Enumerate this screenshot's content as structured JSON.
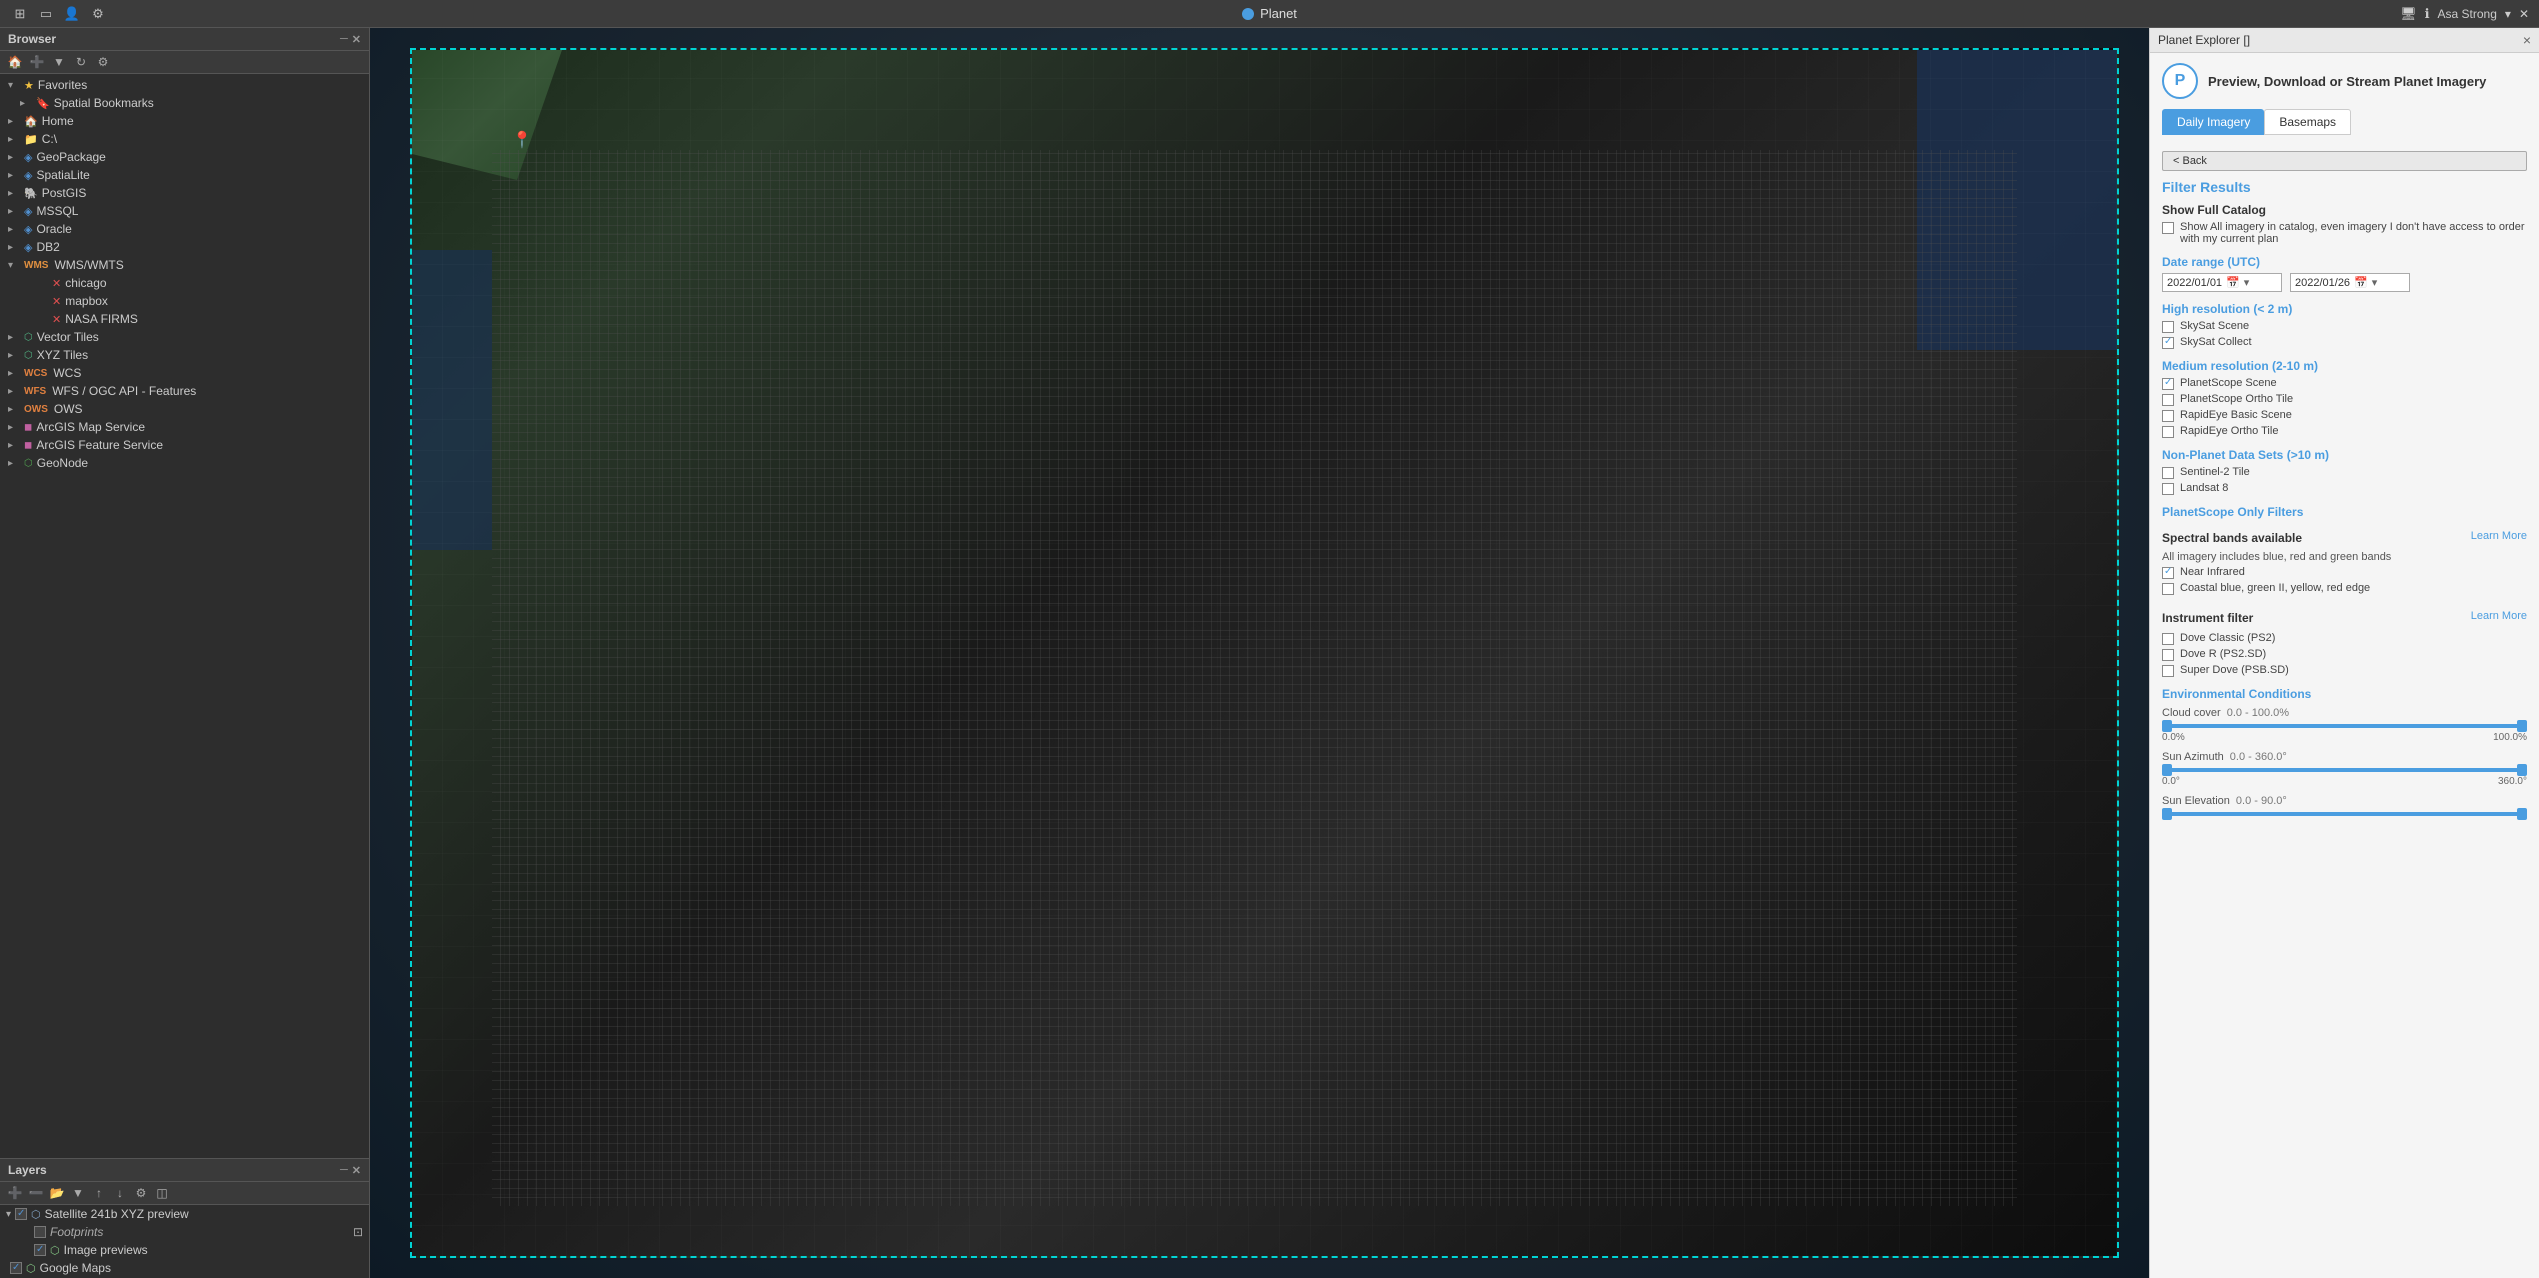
{
  "topbar": {
    "title": "Planet",
    "user": "Asa Strong",
    "icons": [
      "grid-icon",
      "tab-icon",
      "user-icon",
      "settings-icon"
    ]
  },
  "browser": {
    "panel_title": "Browser",
    "toolbar_icons": [
      "home-icon",
      "add-icon",
      "filter-icon",
      "refresh-icon",
      "settings-icon"
    ],
    "tree_items": [
      {
        "label": "Favorites",
        "indent": 0,
        "type": "star",
        "expanded": true
      },
      {
        "label": "Spatial Bookmarks",
        "indent": 1,
        "type": "bookmark"
      },
      {
        "label": "Home",
        "indent": 0,
        "type": "folder",
        "expanded": false
      },
      {
        "label": "C:\\",
        "indent": 0,
        "type": "folder",
        "expanded": false
      },
      {
        "label": "GeoPackage",
        "indent": 0,
        "type": "folder",
        "expanded": false
      },
      {
        "label": "SpatiaLite",
        "indent": 0,
        "type": "folder",
        "expanded": false
      },
      {
        "label": "PostGIS",
        "indent": 0,
        "type": "db",
        "expanded": false
      },
      {
        "label": "MSSQL",
        "indent": 0,
        "type": "db",
        "expanded": false
      },
      {
        "label": "Oracle",
        "indent": 0,
        "type": "db",
        "expanded": false
      },
      {
        "label": "DB2",
        "indent": 0,
        "type": "db",
        "expanded": false
      },
      {
        "label": "WMS/WMTS",
        "indent": 0,
        "type": "wms",
        "expanded": true
      },
      {
        "label": "chicago",
        "indent": 1,
        "type": "cross"
      },
      {
        "label": "mapbox",
        "indent": 1,
        "type": "cross"
      },
      {
        "label": "NASA FIRMS",
        "indent": 1,
        "type": "cross"
      },
      {
        "label": "Vector Tiles",
        "indent": 0,
        "type": "tile",
        "expanded": false
      },
      {
        "label": "XYZ Tiles",
        "indent": 0,
        "type": "tile",
        "expanded": false
      },
      {
        "label": "WCS",
        "indent": 0,
        "type": "wms",
        "expanded": false
      },
      {
        "label": "WFS / OGC API - Features",
        "indent": 0,
        "type": "wms",
        "expanded": false
      },
      {
        "label": "OWS",
        "indent": 0,
        "type": "wms",
        "expanded": false
      },
      {
        "label": "ArcGIS Map Service",
        "indent": 0,
        "type": "tile",
        "expanded": false
      },
      {
        "label": "ArcGIS Feature Service",
        "indent": 0,
        "type": "tile",
        "expanded": false
      },
      {
        "label": "GeoNode",
        "indent": 0,
        "type": "tile",
        "expanded": false
      }
    ]
  },
  "layers": {
    "panel_title": "Layers",
    "toolbar_icons": [
      "add-layer",
      "remove-layer",
      "open-layer",
      "filter-layer",
      "move-up",
      "move-down",
      "properties",
      "group"
    ],
    "items": [
      {
        "label": "Satellite 241b XYZ preview",
        "checked": true,
        "visible": true,
        "expanded": true
      },
      {
        "label": "Footprints",
        "checked": false,
        "visible": false,
        "indent": 1
      },
      {
        "label": "Image previews",
        "checked": true,
        "visible": true,
        "indent": 1
      },
      {
        "label": "Google Maps",
        "checked": true,
        "visible": true,
        "indent": 0
      }
    ]
  },
  "planet_explorer": {
    "panel_title": "Planet Explorer []",
    "close_label": "×",
    "logo_letter": "P",
    "header_title": "Preview, Download or Stream Planet Imagery",
    "tabs": [
      {
        "label": "Daily Imagery",
        "active": true
      },
      {
        "label": "Basemaps",
        "active": false
      }
    ],
    "back_btn": "< Back",
    "filter_results_title": "Filter Results",
    "show_full_catalog_label": "Show Full Catalog",
    "full_catalog_text": "Show All imagery in catalog, even imagery I don't have access to order with my current plan",
    "date_range_label": "Date range (UTC)",
    "date_start": "2022/01/01",
    "date_end": "2022/01/26",
    "high_res_label": "High resolution (< 2 m)",
    "high_res_items": [
      {
        "label": "SkySat Scene",
        "checked": false
      },
      {
        "label": "SkySat Collect",
        "checked": true
      }
    ],
    "medium_res_label": "Medium resolution (2-10 m)",
    "medium_res_items": [
      {
        "label": "PlanetScope Scene",
        "checked": true
      },
      {
        "label": "PlanetScope Ortho Tile",
        "checked": false
      },
      {
        "label": "RapidEye Basic Scene",
        "checked": false
      },
      {
        "label": "RapidEye Ortho Tile",
        "checked": false
      }
    ],
    "non_planet_label": "Non-Planet Data Sets (>10 m)",
    "non_planet_items": [
      {
        "label": "Sentinel-2 Tile",
        "checked": false
      },
      {
        "label": "Landsat 8",
        "checked": false
      }
    ],
    "planetscope_only_label": "PlanetScope Only Filters",
    "spectral_bands_label": "Spectral bands available",
    "spectral_bands_learn_more": "Learn More",
    "spectral_info": "All imagery includes blue, red and green bands",
    "spectral_items": [
      {
        "label": "Near Infrared",
        "checked": true
      },
      {
        "label": "Coastal blue, green II, yellow, red edge",
        "checked": false
      }
    ],
    "instrument_filter_label": "Instrument filter",
    "instrument_learn_more": "Learn More",
    "instrument_items": [
      {
        "label": "Dove Classic (PS2)",
        "checked": false
      },
      {
        "label": "Dove R (PS2.SD)",
        "checked": false
      },
      {
        "label": "Super Dove (PSB.SD)",
        "checked": false
      }
    ],
    "environmental_label": "Environmental Conditions",
    "cloud_cover_label": "Cloud cover",
    "cloud_cover_range": "0.0 - 100.0%",
    "cloud_cover_min": "0.0%",
    "cloud_cover_max": "100.0%",
    "sun_azimuth_label": "Sun Azimuth",
    "sun_azimuth_range": "0.0 - 360.0°",
    "sun_azimuth_min": "0.0°",
    "sun_azimuth_max": "360.0°",
    "sun_elevation_label": "Sun Elevation",
    "sun_elevation_range": "0.0 - 90.0°"
  }
}
